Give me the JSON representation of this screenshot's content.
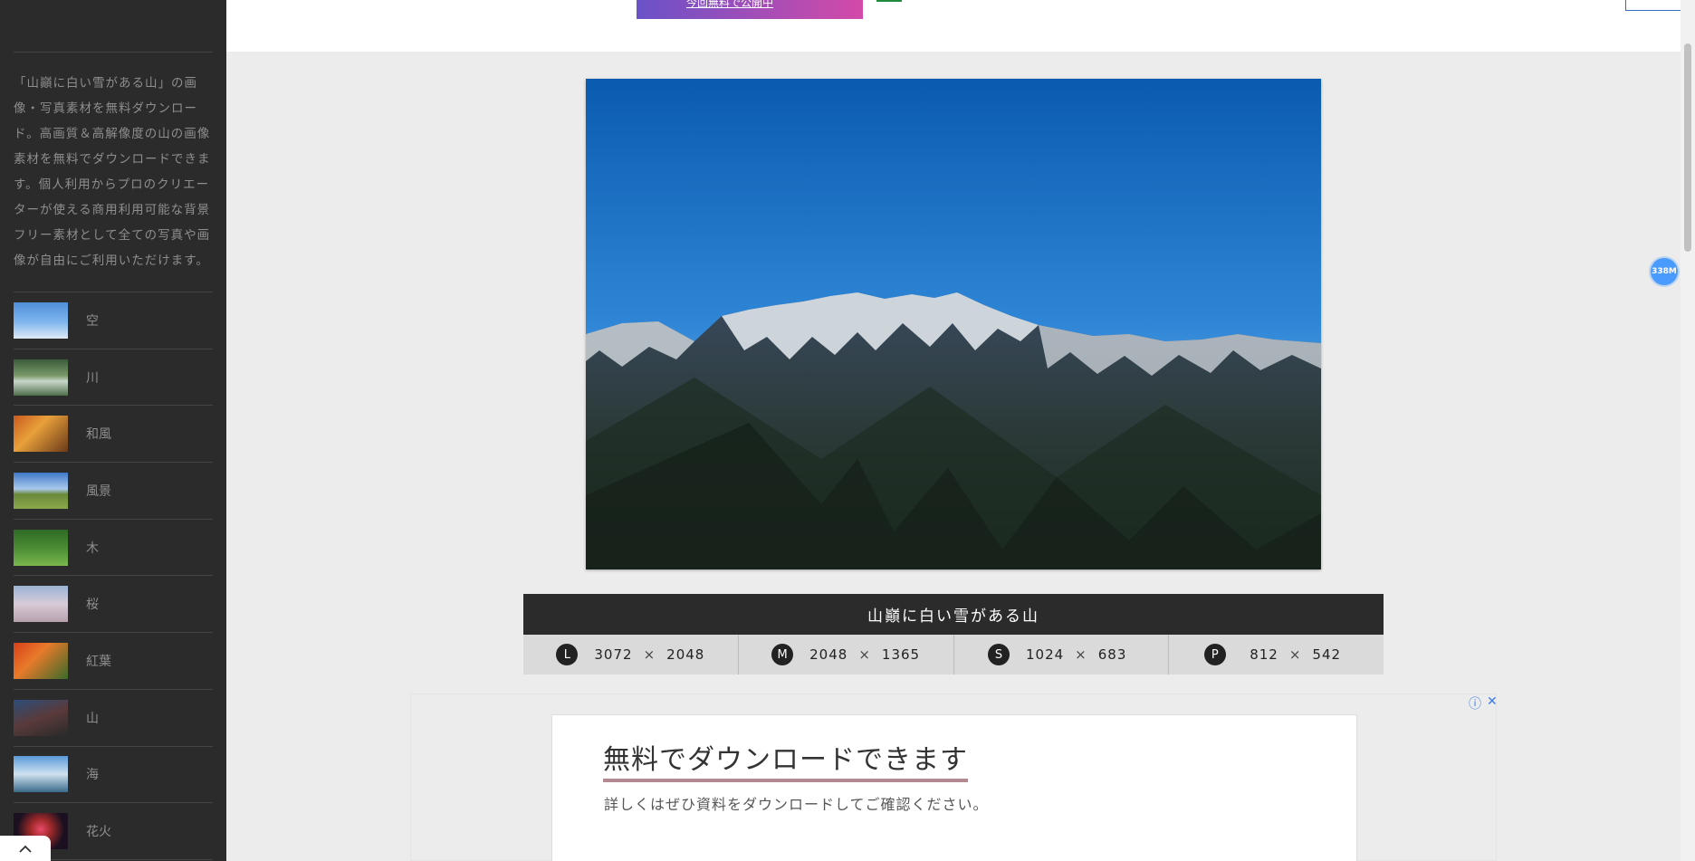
{
  "sidebar": {
    "description": "「山巓に白い雪がある山」の画像・写真素材を無料ダウンロード。高画質＆高解像度の山の画像素材を無料でダウンロードできます。個人利用からプロのクリエーターが使える商用利用可能な背景フリー素材として全ての写真や画像が自由にご利用いただけます。",
    "categories": [
      {
        "label": "空",
        "thumb": "sky"
      },
      {
        "label": "川",
        "thumb": "river"
      },
      {
        "label": "和風",
        "thumb": "japanese"
      },
      {
        "label": "風景",
        "thumb": "landscape"
      },
      {
        "label": "木",
        "thumb": "tree"
      },
      {
        "label": "桜",
        "thumb": "sakura"
      },
      {
        "label": "紅葉",
        "thumb": "autumn"
      },
      {
        "label": "山",
        "thumb": "mountain"
      },
      {
        "label": "海",
        "thumb": "sea"
      },
      {
        "label": "花火",
        "thumb": "fireworks"
      }
    ],
    "back_to_top_icon": "chevron-up-icon"
  },
  "header": {
    "banner_text": "今回無料で公開中"
  },
  "memory_badge": "338M",
  "photo": {
    "title": "山巓に白い雪がある山"
  },
  "sizes": [
    {
      "badge": "L",
      "width": "3072",
      "x": "×",
      "height": "2048"
    },
    {
      "badge": "M",
      "width": "2048",
      "x": "×",
      "height": "1365"
    },
    {
      "badge": "S",
      "width": "1024",
      "x": "×",
      "height": "683"
    },
    {
      "badge": "P",
      "width": "812",
      "x": "×",
      "height": "542"
    }
  ],
  "ad": {
    "headline": "無料でダウンロードできます",
    "sub": "詳しくはぜひ資料をダウンロードしてご確認ください。",
    "info_icon": "ⓘ",
    "close_icon": "✕"
  }
}
